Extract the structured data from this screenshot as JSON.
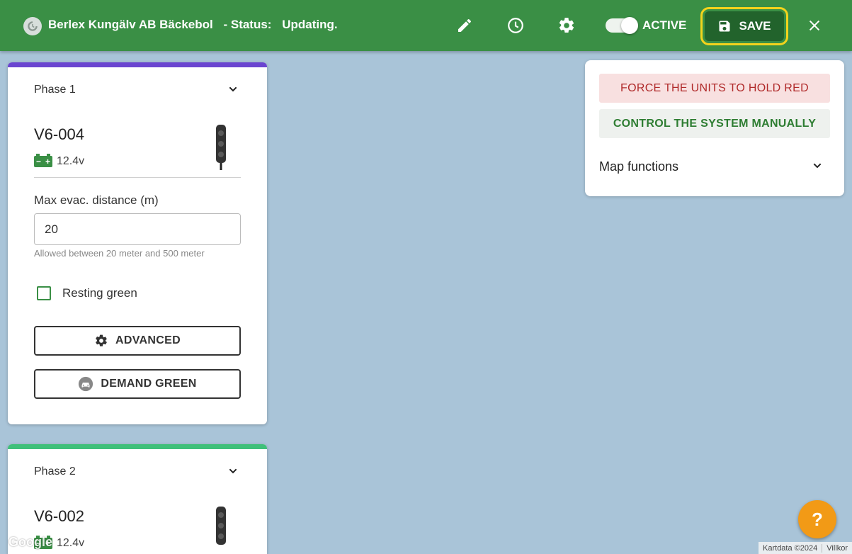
{
  "header": {
    "title": "Berlex Kungälv AB Bäckebol",
    "status_label": "- Status:",
    "status_value": "Updating.",
    "active_label": "ACTIVE",
    "save_label": "SAVE",
    "active_toggle_on": true,
    "icons": [
      "brand-logo-icon",
      "pencil-icon",
      "clock-icon",
      "gear-icon",
      "save-disk-icon",
      "close-icon"
    ]
  },
  "phases": [
    {
      "title": "Phase 1",
      "accent_color": "#6a45d0",
      "unit": "V6-004",
      "battery": "12.4v",
      "evac_label": "Max evac. distance (m)",
      "evac_value": "20",
      "evac_hint": "Allowed between 20 meter and 500 meter",
      "resting_green_label": "Resting green",
      "resting_green_checked": false,
      "advanced_label": "ADVANCED",
      "demand_green_label": "DEMAND GREEN"
    },
    {
      "title": "Phase 2",
      "accent_color": "#3fc07a",
      "unit": "V6-002",
      "battery": "12.4v"
    }
  ],
  "right_panel": {
    "force_red_label": "FORCE THE UNITS TO HOLD RED",
    "control_manually_label": "CONTROL THE SYSTEM MANUALLY",
    "map_functions_label": "Map functions"
  },
  "map": {
    "logo_text": "Google",
    "attribution": "Kartdata ©2024",
    "terms": "Villkor"
  },
  "help_label": "?",
  "colors": {
    "header_green": "#3a8f45",
    "save_bg": "#22632c",
    "save_highlight": "#f3d31c",
    "map_bg": "#a9c4d8",
    "help_orange": "#f29a16"
  }
}
